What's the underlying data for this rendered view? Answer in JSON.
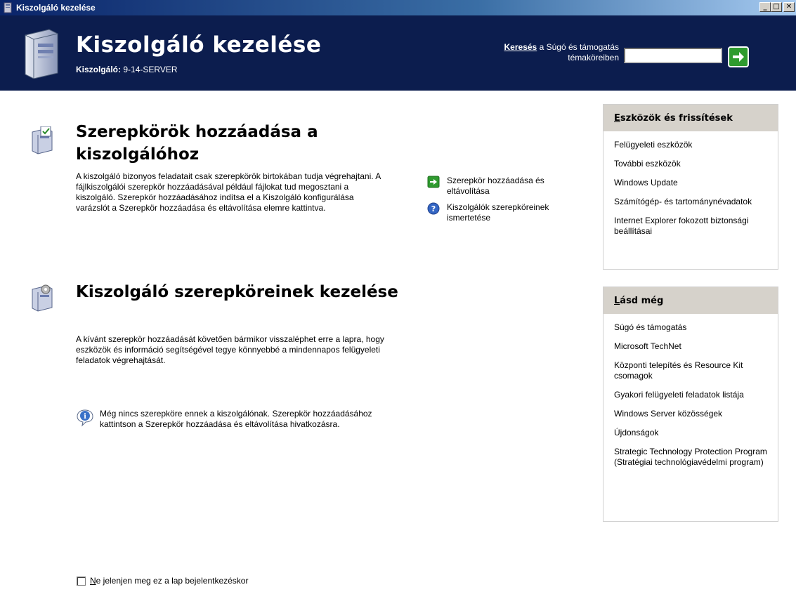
{
  "window": {
    "title": "Kiszolgáló kezelése",
    "buttons": {
      "minimize": "_",
      "maximize": "□",
      "close": "✕"
    }
  },
  "header": {
    "title": "Kiszolgáló kezelése",
    "server_label": "Kiszolgáló:",
    "server_name": "9-14-SERVER",
    "search_strong": "Keresés",
    "search_rest": "a Súgó és támogatás",
    "search_line2": "témaköreiben",
    "search_value": ""
  },
  "sections": {
    "add_roles": {
      "title": "Szerepkörök hozzáadása a kiszolgálóhoz",
      "description": "A kiszolgáló bizonyos feladatait csak szerepkörök birtokában tudja végrehajtani. A fájlkiszolgálói szerepkör hozzáadásával például fájlokat tud megosztani a kiszolgáló. Szerepkör hozzáadásához indítsa el a Kiszolgáló konfigurálása varázslót a Szerepkör hozzáadása és eltávolítása elemre kattintva."
    },
    "manage_roles": {
      "title": "Kiszolgáló szerepköreinek kezelése",
      "description": "A kívánt szerepkör hozzáadását követően bármikor visszaléphet erre a lapra, hogy eszközök és információ segítségével tegye könnyebbé a mindennapos felügyeleti feladatok végrehajtását.",
      "info": "Még nincs szerepköre ennek a kiszolgálónak. Szerepkör hozzáadásához kattintson a Szerepkör hozzáadása és eltávolítása hivatkozásra."
    }
  },
  "actions": {
    "add_remove": "Szerepkör hozzáadása és eltávolítása",
    "read_about": "Kiszolgálók szerepköreinek ismertetése"
  },
  "tools_panel": {
    "heading_first": "E",
    "heading_rest": "szközök és frissítések",
    "items": [
      "Felügyeleti eszközök",
      "További eszközök",
      "Windows Update",
      "Számítógép- és tartománynévadatok",
      "Internet Explorer fokozott biztonsági beállításai"
    ]
  },
  "see_also_panel": {
    "heading_first": "L",
    "heading_rest": "ásd még",
    "items": [
      "Súgó és támogatás",
      "Microsoft TechNet",
      "Központi telepítés és Resource Kit csomagok",
      "Gyakori felügyeleti feladatok listája",
      "Windows Server közösségek",
      "Újdonságok",
      "Strategic Technology Protection Program (Stratégiai technológiavédelmi program)"
    ]
  },
  "footer": {
    "checkbox_first": "N",
    "checkbox_rest": "e jelenjen meg ez a lap bejelentkezéskor",
    "checked": false
  },
  "colors": {
    "header_bg": "#0c1d4e",
    "panel_head_bg": "#d6d2cb",
    "go_button": "#2f9b2f"
  }
}
